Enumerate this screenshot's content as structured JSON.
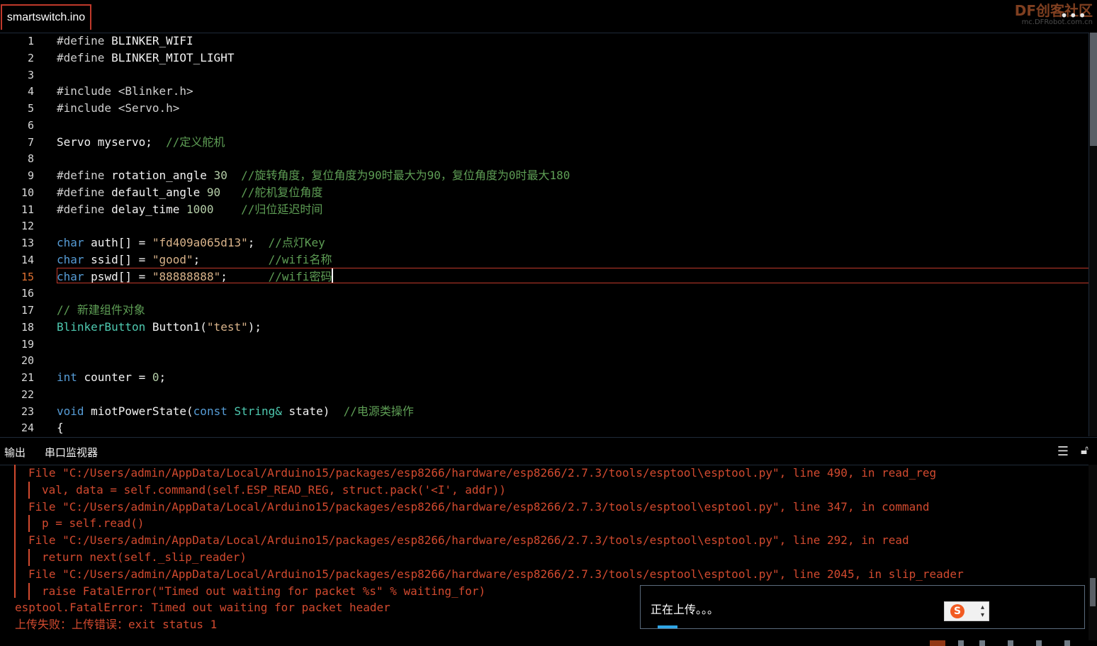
{
  "tabbar": {
    "active_tab": "smartswitch.ino",
    "more_icon": "more-horizontal-icon"
  },
  "watermark": {
    "brand": "DF创客社区",
    "url": "mc.DFRobot.com.cn"
  },
  "editor": {
    "current_line": 15,
    "lines": [
      {
        "n": "1",
        "segs": [
          [
            "#define ",
            "t-def"
          ],
          [
            "BLINKER_WIFI",
            "t-plain"
          ]
        ]
      },
      {
        "n": "2",
        "segs": [
          [
            "#define ",
            "t-def"
          ],
          [
            "BLINKER_MIOT_LIGHT",
            "t-plain"
          ]
        ]
      },
      {
        "n": "3",
        "segs": []
      },
      {
        "n": "4",
        "segs": [
          [
            "#include ",
            "t-inc"
          ],
          [
            "<Blinker.h>",
            "t-inc"
          ]
        ]
      },
      {
        "n": "5",
        "segs": [
          [
            "#include ",
            "t-inc"
          ],
          [
            "<Servo.h>",
            "t-inc"
          ]
        ]
      },
      {
        "n": "6",
        "segs": []
      },
      {
        "n": "7",
        "segs": [
          [
            "Servo myservo;  ",
            "t-plain"
          ],
          [
            "//定义舵机",
            "t-com"
          ]
        ]
      },
      {
        "n": "8",
        "segs": []
      },
      {
        "n": "9",
        "segs": [
          [
            "#define ",
            "t-def"
          ],
          [
            "rotation_angle ",
            "t-plain"
          ],
          [
            "30",
            "t-num"
          ],
          [
            "  //旋转角度，复位角度为90时最大为90，复位角度为0时最大180",
            "t-com"
          ]
        ]
      },
      {
        "n": "10",
        "segs": [
          [
            "#define ",
            "t-def"
          ],
          [
            "default_angle ",
            "t-plain"
          ],
          [
            "90",
            "t-num"
          ],
          [
            "   //舵机复位角度",
            "t-com"
          ]
        ]
      },
      {
        "n": "11",
        "segs": [
          [
            "#define ",
            "t-def"
          ],
          [
            "delay_time ",
            "t-plain"
          ],
          [
            "1000",
            "t-num"
          ],
          [
            "    //归位延迟时间",
            "t-com"
          ]
        ]
      },
      {
        "n": "12",
        "segs": []
      },
      {
        "n": "13",
        "segs": [
          [
            "char ",
            "t-kw"
          ],
          [
            "auth[] = ",
            "t-plain"
          ],
          [
            "\"fd409a065d13\"",
            "t-str"
          ],
          [
            ";  ",
            "t-plain"
          ],
          [
            "//点灯Key",
            "t-com"
          ]
        ]
      },
      {
        "n": "14",
        "segs": [
          [
            "char ",
            "t-kw"
          ],
          [
            "ssid[] = ",
            "t-plain"
          ],
          [
            "\"good\"",
            "t-str"
          ],
          [
            ";          ",
            "t-plain"
          ],
          [
            "//wifi名称",
            "t-com"
          ]
        ]
      },
      {
        "n": "15",
        "segs": [
          [
            "char ",
            "t-kw"
          ],
          [
            "pswd[] = ",
            "t-plain"
          ],
          [
            "\"88888888\"",
            "t-str"
          ],
          [
            ";      ",
            "t-plain"
          ],
          [
            "//wifi密码",
            "t-com"
          ]
        ]
      },
      {
        "n": "16",
        "segs": []
      },
      {
        "n": "17",
        "segs": [
          [
            "// 新建组件对象",
            "t-com"
          ]
        ]
      },
      {
        "n": "18",
        "segs": [
          [
            "BlinkerButton ",
            "t-type"
          ],
          [
            "Button1(",
            "t-plain"
          ],
          [
            "\"test\"",
            "t-str"
          ],
          [
            ");",
            "t-plain"
          ]
        ]
      },
      {
        "n": "19",
        "segs": []
      },
      {
        "n": "20",
        "segs": []
      },
      {
        "n": "21",
        "segs": [
          [
            "int ",
            "t-kw"
          ],
          [
            "counter = ",
            "t-plain"
          ],
          [
            "0",
            "t-num"
          ],
          [
            ";",
            "t-plain"
          ]
        ]
      },
      {
        "n": "22",
        "segs": []
      },
      {
        "n": "23",
        "segs": [
          [
            "void ",
            "t-kw"
          ],
          [
            "miotPowerState(",
            "t-plain"
          ],
          [
            "const ",
            "t-kw"
          ],
          [
            "String& ",
            "t-type"
          ],
          [
            "state)  ",
            "t-plain"
          ],
          [
            "//电源类操作",
            "t-com"
          ]
        ]
      },
      {
        "n": "24",
        "segs": [
          [
            "{",
            "t-plain"
          ]
        ]
      }
    ]
  },
  "panel": {
    "tabs": [
      "输出",
      "串口监视器"
    ],
    "menu_icon": "list-icon",
    "lock_icon": "unlock-icon"
  },
  "output": {
    "lines": [
      {
        "text": "File \"C:/Users/admin/AppData/Local/Arduino15/packages/esp8266/hardware/esp8266/2.7.3/tools/esptool\\esptool.py\", line 490, in read_reg",
        "indent": 1
      },
      {
        "text": "val, data = self.command(self.ESP_READ_REG, struct.pack('<I', addr))",
        "indent": 2
      },
      {
        "text": "File \"C:/Users/admin/AppData/Local/Arduino15/packages/esp8266/hardware/esp8266/2.7.3/tools/esptool\\esptool.py\", line 347, in command",
        "indent": 1
      },
      {
        "text": "p = self.read()",
        "indent": 2
      },
      {
        "text": "File \"C:/Users/admin/AppData/Local/Arduino15/packages/esp8266/hardware/esp8266/2.7.3/tools/esptool\\esptool.py\", line 292, in read",
        "indent": 1
      },
      {
        "text": "return next(self._slip_reader)",
        "indent": 2
      },
      {
        "text": "File \"C:/Users/admin/AppData/Local/Arduino15/packages/esp8266/hardware/esp8266/2.7.3/tools/esptool\\esptool.py\", line 2045, in slip_reader",
        "indent": 1
      },
      {
        "text": "raise FatalError(\"Timed out waiting for packet %s\" % waiting_for)",
        "indent": 2
      },
      {
        "text": "esptool.FatalError: Timed out waiting for packet header",
        "indent": 0
      },
      {
        "text": "上传失败：上传错误：exit status 1",
        "indent": 0
      }
    ]
  },
  "toast": {
    "message": "正在上传。。。",
    "ime_label": "S"
  },
  "colors": {
    "accent_red": "#c0392b",
    "error_text": "#d24a2f",
    "progress_blue": "#2fa6e6"
  }
}
